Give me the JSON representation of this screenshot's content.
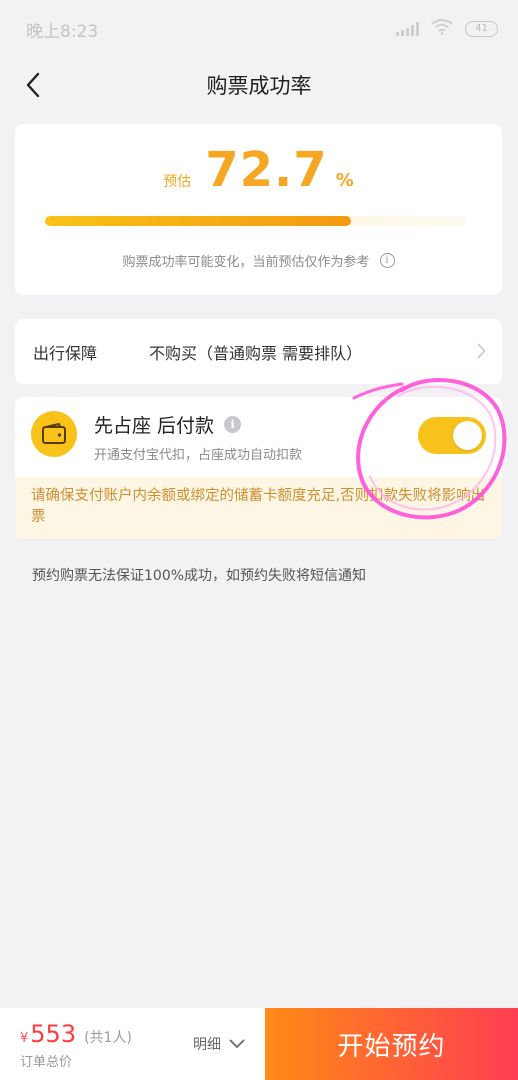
{
  "status_bar": {
    "time": "晚上8:23",
    "battery": "41"
  },
  "nav": {
    "title": "购票成功率"
  },
  "success_rate": {
    "prefix": "预估",
    "value": "72.7",
    "unit": "%",
    "progress": 0.727,
    "note": "购票成功率可能变化，当前预估仅作为参考"
  },
  "guarantee": {
    "label": "出行保障",
    "value": "不购买（普通购票 需要排队）"
  },
  "prepay": {
    "title": "先占座 后付款",
    "subtitle": "开通支付宝代扣，占座成功自动扣款",
    "toggle_on": true,
    "warning": "请确保支付账户内余额或绑定的储蓄卡额度充足,否则扣款失败将影响出票"
  },
  "notice": "预约购票无法保证100%成功，如预约失败将短信通知",
  "footer": {
    "currency": "¥",
    "price": "553",
    "count": "(共1人)",
    "total_label": "订单总价",
    "detail": "明细",
    "cta": "开始预约"
  },
  "colors": {
    "accent": "#f5a623",
    "price": "#ff3b3b",
    "annotation": "#ff4fd8"
  }
}
